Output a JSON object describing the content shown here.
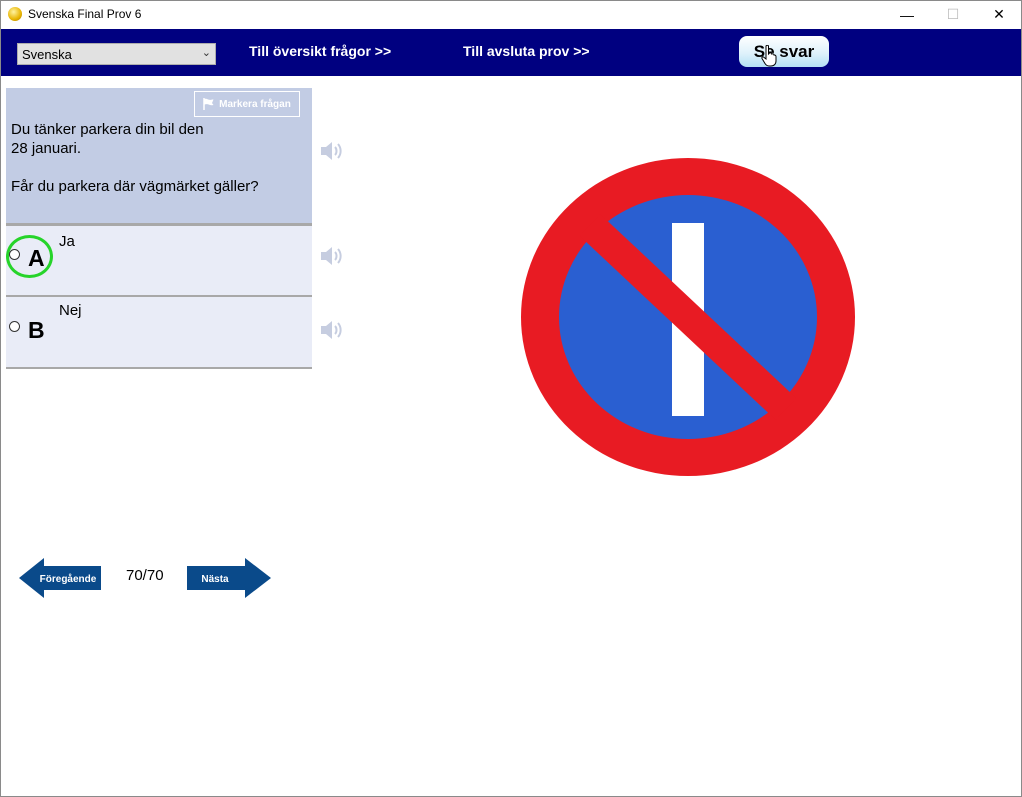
{
  "window": {
    "title": "Svenska Final Prov 6",
    "controls": {
      "minimize": "—",
      "maximize": "☐",
      "close": "✕"
    }
  },
  "nav": {
    "language": "Svenska",
    "overview_link": "Till översikt frågor >>",
    "finish_link": "Till avsluta prov  >>",
    "show_answer": "Se svar"
  },
  "question": {
    "flag_label": "Markera frågan",
    "line1": "Du tänker parkera din bil den",
    "line2": "28 januari.",
    "line3": "Får du parkera där vägmärket gäller?"
  },
  "answers": [
    {
      "letter": "A",
      "text": "Ja",
      "highlighted": true
    },
    {
      "letter": "B",
      "text": "Nej",
      "highlighted": false
    }
  ],
  "pagination": {
    "prev_label": "Föregående",
    "next_label": "Nästa",
    "counter": "70/70"
  },
  "colors": {
    "nav_bg": "#000080",
    "question_bg": "#c2cce4",
    "answer_bg": "#e9ecf7",
    "button_blue": "#0a4a8a",
    "sign_red": "#e81b23",
    "sign_blue": "#2a5fd1",
    "highlight_green": "#26d42a"
  },
  "icons": [
    "flag-icon",
    "speaker-icon",
    "left-arrow-icon",
    "right-arrow-icon",
    "hand-cursor-icon",
    "app-icon"
  ]
}
